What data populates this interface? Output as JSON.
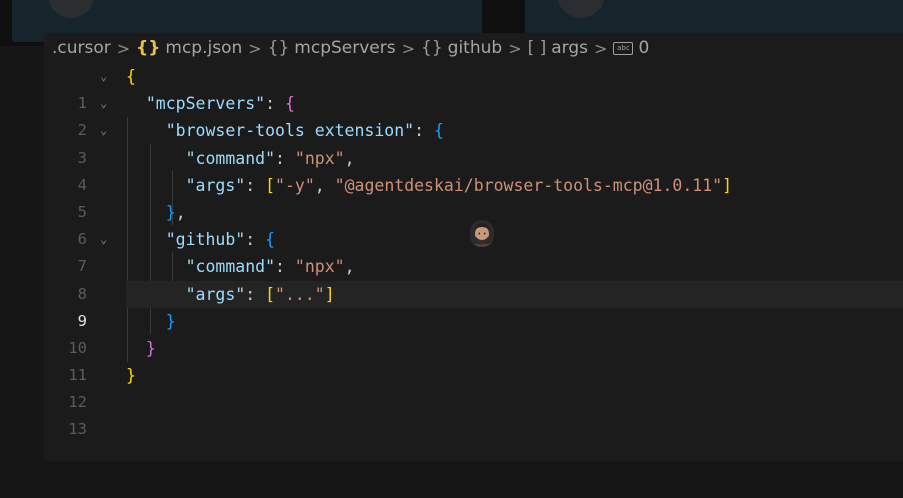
{
  "breadcrumb": {
    "folder": ".cursor",
    "file": "mcp.json",
    "obj1": "mcpServers",
    "obj2": "github",
    "arr": "args",
    "index": "0",
    "file_icon": "{}",
    "obj_icon": "{}",
    "arr_icon": "[ ]",
    "string_icon": "abc",
    "separator": ">"
  },
  "editor": {
    "active_line": 9,
    "lines": [
      {
        "num": "1"
      },
      {
        "num": "2"
      },
      {
        "num": "3"
      },
      {
        "num": "4"
      },
      {
        "num": "5"
      },
      {
        "num": "6"
      },
      {
        "num": "7"
      },
      {
        "num": "8"
      },
      {
        "num": "9"
      },
      {
        "num": "10"
      },
      {
        "num": "11"
      },
      {
        "num": "12"
      },
      {
        "num": "13"
      }
    ],
    "tokens": {
      "mcpServers_key": "\"mcpServers\"",
      "browser_tools_key": "\"browser-tools extension\"",
      "command_key": "\"command\"",
      "npx_val": "\"npx\"",
      "args_key": "\"args\"",
      "y_arg": "\"-y\"",
      "browser_pkg_arg": "\"@agentdeskai/browser-tools-mcp@1.0.11\"",
      "github_key": "\"github\"",
      "dots_arg": "\"...\""
    }
  },
  "colors": {
    "key": "#9cdcfe",
    "string": "#ce9178",
    "bracket_level1": "#ffd700",
    "bracket_level2": "#da70d6",
    "bracket_level3": "#179fff"
  },
  "cursor_avatar": "person-avatar"
}
